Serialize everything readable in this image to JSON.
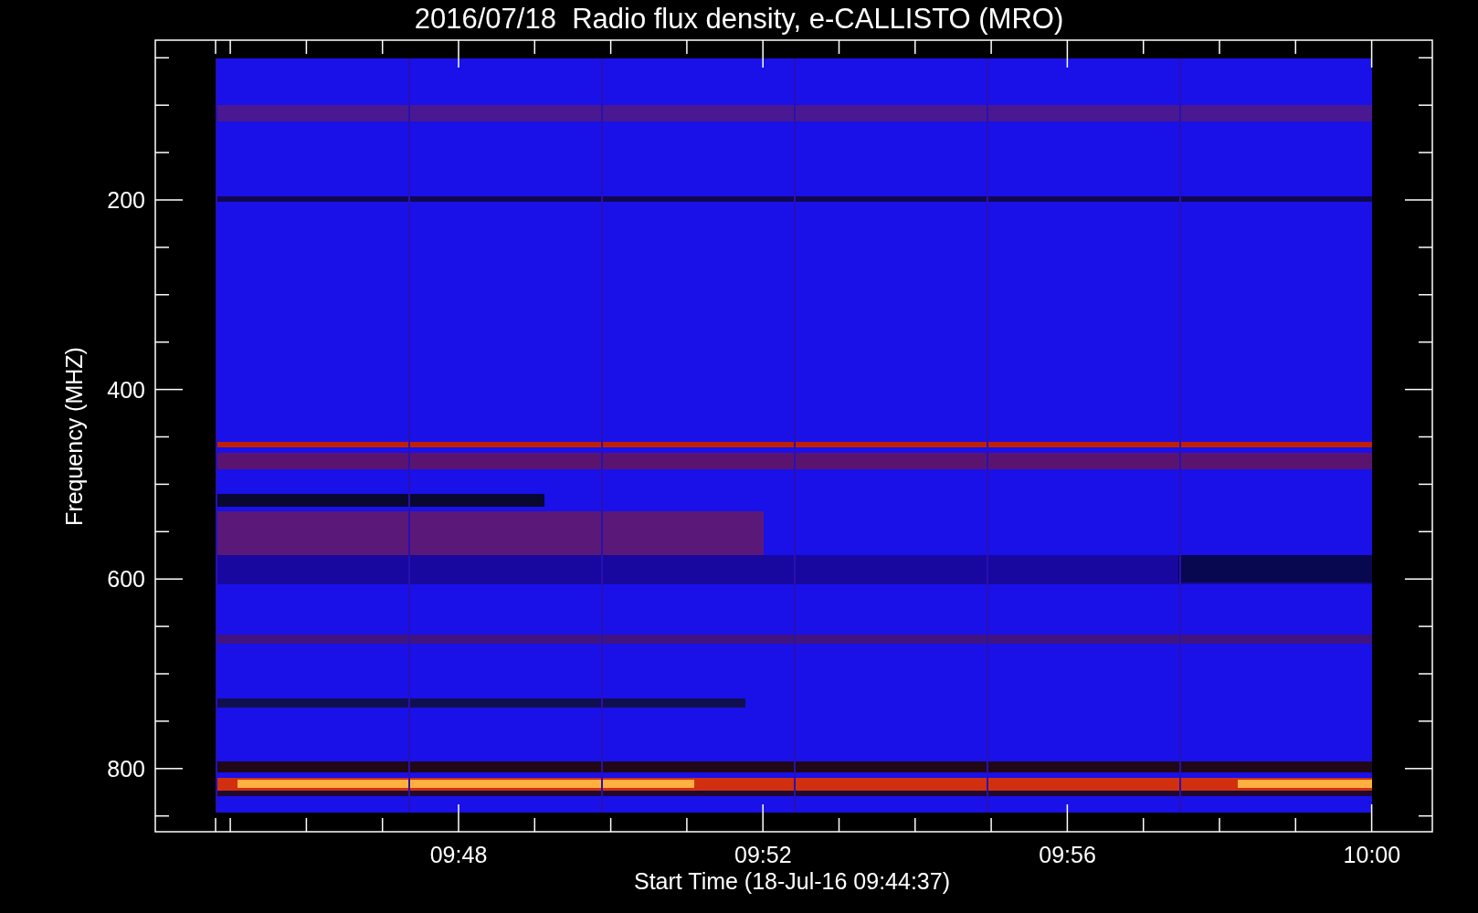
{
  "title": "2016/07/18  Radio flux density, e-CALLISTO (MRO)",
  "y_axis": {
    "label": "Frequency (MHZ)",
    "ticks": [
      "200",
      "400",
      "600",
      "800"
    ]
  },
  "x_axis": {
    "label": "Start Time (18-Jul-16 09:44:37)",
    "ticks": [
      "09:48",
      "09:52",
      "09:56",
      "10:00"
    ]
  }
}
